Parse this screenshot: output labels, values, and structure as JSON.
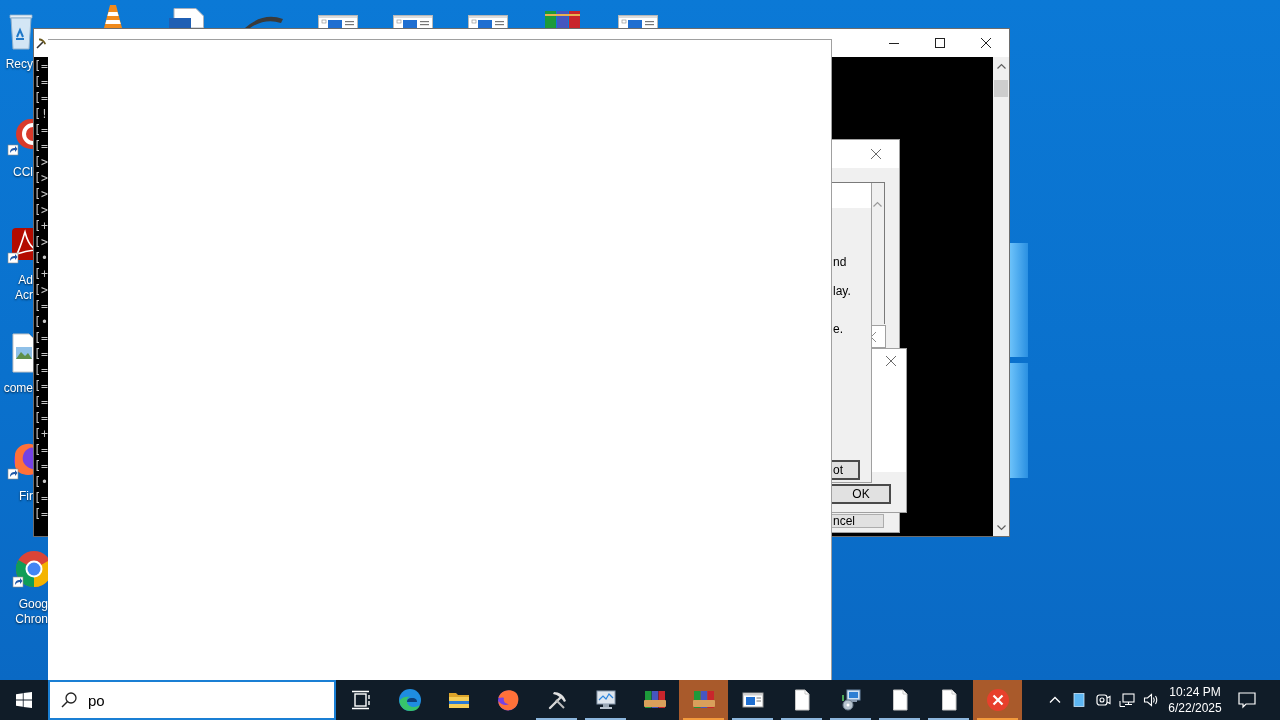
{
  "desktop": {
    "left_icons": [
      {
        "kind": "recycle-bin",
        "label": "Recy",
        "shortcut": false
      },
      {
        "kind": "c-logo",
        "label": "CCl",
        "shortcut": true
      },
      {
        "kind": "swirl-logo",
        "label": "Ad Acr",
        "shortcut": true
      },
      {
        "kind": "image-file",
        "label": "come",
        "shortcut": false
      },
      {
        "kind": "globe-logo",
        "label": "Fir",
        "shortcut": true
      },
      {
        "kind": "ring-logo",
        "label": "Goog Chron",
        "shortcut": true
      }
    ],
    "top_icons": [
      {
        "kind": "cone"
      },
      {
        "kind": "document"
      },
      {
        "kind": "arc"
      },
      {
        "kind": "window"
      },
      {
        "kind": "window"
      },
      {
        "kind": "window"
      },
      {
        "kind": "books"
      },
      {
        "kind": "window"
      }
    ]
  },
  "console": {
    "lines": [
      "[=",
      "[=",
      "[=",
      "[!",
      "[=",
      "[=",
      "[>",
      "[>",
      "[>",
      "[>",
      "[+",
      "[>",
      "[•",
      "[+",
      "[>",
      "[=",
      "[•",
      "[=",
      "[=",
      "[=",
      "[=",
      "[=",
      "[=",
      "[+",
      "[=",
      "[=",
      "[•",
      "[=",
      "[="
    ]
  },
  "list_dialog": {
    "buttons": [
      {
        "label": "ncel",
        "default": false
      }
    ]
  },
  "message_dialog": {
    "lines": [
      "nd",
      "lay.",
      "e."
    ],
    "buttons": [
      {
        "label": "ot",
        "default": true
      }
    ]
  },
  "ok_dialog": {
    "buttons": [
      {
        "label": "OK",
        "default": true
      }
    ]
  },
  "taskbar": {
    "search": {
      "value": "po"
    },
    "apps": [
      {
        "kind": "wave-logo",
        "running": false,
        "flashing": false
      },
      {
        "kind": "folder",
        "running": false,
        "flashing": false
      },
      {
        "kind": "globe-logo",
        "running": false,
        "flashing": false
      },
      {
        "kind": "pickaxe",
        "running": true,
        "flashing": false
      },
      {
        "kind": "monitor",
        "running": true,
        "flashing": false
      },
      {
        "kind": "books",
        "running": false,
        "flashing": false
      },
      {
        "kind": "books",
        "running": true,
        "flashing": true
      },
      {
        "kind": "window",
        "running": true,
        "flashing": false
      },
      {
        "kind": "document",
        "running": true,
        "flashing": false
      },
      {
        "kind": "setup",
        "running": true,
        "flashing": false
      },
      {
        "kind": "document",
        "running": true,
        "flashing": false
      },
      {
        "kind": "document",
        "running": true,
        "flashing": false
      },
      {
        "kind": "error",
        "running": true,
        "flashing": true
      }
    ],
    "clock": {
      "time": "10:24 PM",
      "date": "6/22/2025"
    }
  }
}
